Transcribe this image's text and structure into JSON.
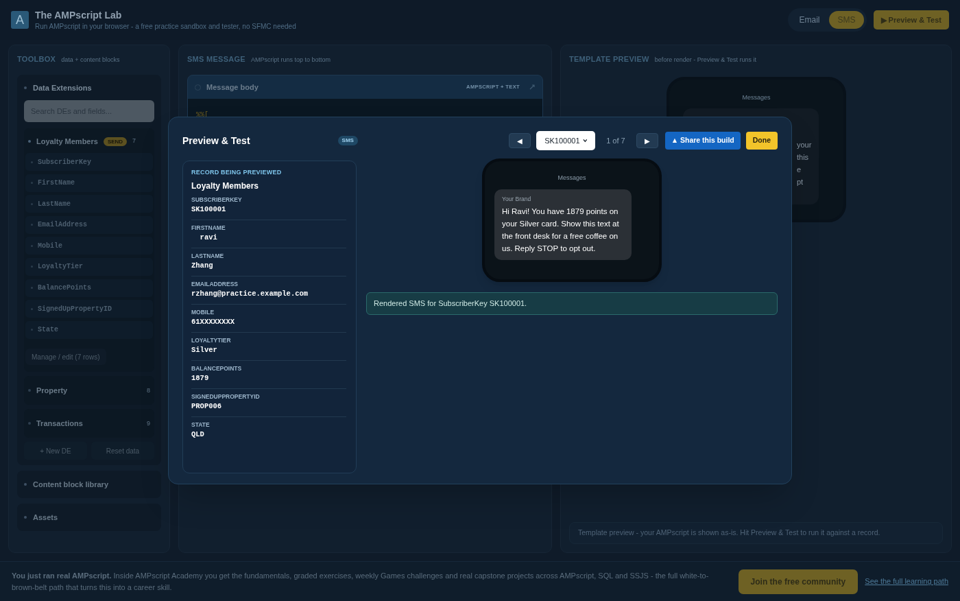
{
  "header": {
    "logo_text": "A",
    "title": "The AMPscript Lab",
    "subtitle": "Run AMPscript in your browser - a free practice sandbox and tester, no SFMC needed"
  },
  "mode_tabs": [
    {
      "label": "Email",
      "selected": false
    },
    {
      "label": "SMS",
      "selected": true
    }
  ],
  "preview_button": "▶ Preview & Test",
  "toolbox": {
    "title": "TOOLBOX",
    "hint": "data + content blocks",
    "data_extensions": {
      "title": "Data Extensions",
      "expanded": true,
      "search_placeholder": "Search DEs and fields...",
      "items": [
        {
          "name": "Loyalty Members",
          "badge": "SEND",
          "count": "7",
          "expanded": true,
          "fields": [
            "SubscriberKey",
            "FirstName",
            "LastName",
            "EmailAddress",
            "Mobile",
            "LoyaltyTier",
            "BalancePoints",
            "SignedUpPropertyID",
            "State"
          ],
          "manage_button": "Manage / edit (7 rows)"
        },
        {
          "name": "Property",
          "count": "8",
          "expanded": false
        },
        {
          "name": "Transactions",
          "count": "9",
          "expanded": false
        }
      ],
      "buttons": [
        "+ New DE",
        "Reset data"
      ]
    },
    "sections": [
      {
        "title": "Content block library",
        "expanded": false
      },
      {
        "title": "Assets",
        "expanded": false
      }
    ]
  },
  "sms_panel": {
    "title": "SMS MESSAGE",
    "hint": "AMPscript runs top to bottom",
    "editor": {
      "title": "Message body",
      "tag": "AMPSCRIPT + TEXT",
      "code": "%%["
    }
  },
  "template_panel": {
    "title": "TEMPLATE PREVIEW",
    "hint": "before render - Preview & Test runs it",
    "phone_header": "Messages",
    "bubble_fragments": [
      "your",
      "this",
      "e",
      "pt"
    ],
    "note": "Template preview - your AMPscript is shown as-is. Hit Preview & Test to run it against a record."
  },
  "modal": {
    "title": "Preview & Test",
    "badge": "SMS",
    "prev": "◀",
    "record_value": "SK100001",
    "position": "1 of 7",
    "next": "▶",
    "share_button": "▲ Share this build",
    "done_button": "Done",
    "record": {
      "heading": "RECORD BEING PREVIEWED",
      "de_name": "Loyalty Members",
      "fields": [
        {
          "label": "SUBSCRIBERKEY",
          "value": "SK100001"
        },
        {
          "label": "FIRSTNAME",
          "value": "  ravi"
        },
        {
          "label": "LASTNAME",
          "value": "Zhang"
        },
        {
          "label": "EMAILADDRESS",
          "value": "rzhang@practice.example.com"
        },
        {
          "label": "MOBILE",
          "value": "61XXXXXXXX"
        },
        {
          "label": "LOYALTYTIER",
          "value": "Silver"
        },
        {
          "label": "BALANCEPOINTS",
          "value": "1879"
        },
        {
          "label": "SIGNEDUPPROPERTYID",
          "value": "PROP006"
        },
        {
          "label": "STATE",
          "value": "QLD"
        }
      ]
    },
    "phone": {
      "header": "Messages",
      "sender": "Your Brand",
      "body": "Hi Ravi! You have 1879 points on your Silver card. Show this text at the front desk for a free coffee on us. Reply STOP to opt out."
    },
    "status": "Rendered SMS for SubscriberKey SK100001."
  },
  "footer": {
    "text": "**You just ran real AMPscript.** Inside AMPscript Academy you get the fundamentals, graded exercises, weekly Games challenges and real capstone projects across AMPscript, SQL and SSJS - the full white-to-brown-belt path that turns this into a career skill.",
    "join_button": "Join the free community",
    "link": "See the full learning path"
  }
}
